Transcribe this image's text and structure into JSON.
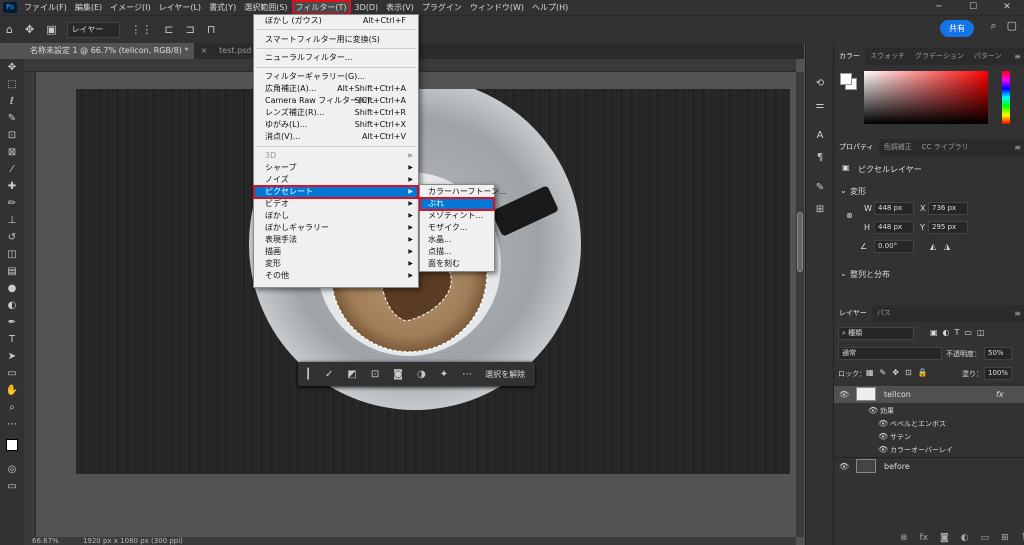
{
  "menubar": {
    "items": [
      "ファイル(F)",
      "編集(E)",
      "イメージ(I)",
      "レイヤー(L)",
      "書式(Y)",
      "選択範囲(S)",
      "フィルター(T)",
      "3D(D)",
      "表示(V)",
      "プラグイン",
      "ウィンドウ(W)",
      "ヘルプ(H)"
    ],
    "active_index": 6
  },
  "options_bar": {
    "layer_select": "レイヤー",
    "share_label": "共有"
  },
  "tabs": [
    {
      "label": "名称未設定 1 @ 66.7% (tellcon, RGB/8) *"
    },
    {
      "label": "test.psd @ 66."
    }
  ],
  "filter_menu": {
    "items": [
      {
        "label": "ぼかし (ガウス)",
        "shortcut": "Alt+Ctrl+F"
      },
      {
        "label": "スマートフィルター用に変換(S)",
        "shortcut": ""
      },
      {
        "label": "ニューラルフィルター...",
        "shortcut": ""
      },
      {
        "label": "フィルターギャラリー(G)...",
        "shortcut": ""
      },
      {
        "label": "広角補正(A)...",
        "shortcut": "Alt+Shift+Ctrl+A"
      },
      {
        "label": "Camera Raw フィルター(C)...",
        "shortcut": "Shift+Ctrl+A"
      },
      {
        "label": "レンズ補正(R)...",
        "shortcut": "Shift+Ctrl+R"
      },
      {
        "label": "ゆがみ(L)...",
        "shortcut": "Shift+Ctrl+X"
      },
      {
        "label": "消点(V)...",
        "shortcut": "Alt+Ctrl+V"
      },
      {
        "label": "3D",
        "shortcut": ""
      },
      {
        "label": "シャープ",
        "shortcut": ""
      },
      {
        "label": "ノイズ",
        "shortcut": ""
      },
      {
        "label": "ピクセレート",
        "shortcut": ""
      },
      {
        "label": "ビデオ",
        "shortcut": ""
      },
      {
        "label": "ぼかし",
        "shortcut": ""
      },
      {
        "label": "ぼかしギャラリー",
        "shortcut": ""
      },
      {
        "label": "表現手法",
        "shortcut": ""
      },
      {
        "label": "描画",
        "shortcut": ""
      },
      {
        "label": "変形",
        "shortcut": ""
      },
      {
        "label": "その他",
        "shortcut": ""
      }
    ]
  },
  "pixelate_submenu": {
    "items": [
      "カラーハーフトーン...",
      "ぶれ",
      "メゾティント...",
      "モザイク...",
      "水晶...",
      "点描...",
      "面を刻む"
    ],
    "highlighted_index": 1
  },
  "context_bar": {
    "deselect_label": "選択を解除"
  },
  "color_panel": {
    "tabs": [
      "カラー",
      "スウォッチ",
      "グラデーション",
      "パターン"
    ]
  },
  "properties_panel": {
    "tabs": [
      "プロパティ",
      "色調補正",
      "CC ライブラリ"
    ],
    "layer_type": "ピクセルレイヤー",
    "transform_label": "変形",
    "w": "448 px",
    "h": "448 px",
    "x": "736 px",
    "y": "295 px",
    "angle": "0.00°",
    "align_label": "整列と分布"
  },
  "layers_panel": {
    "tabs": [
      "レイヤー",
      "パス"
    ],
    "filter_kind": "種類",
    "blend_mode": "通常",
    "opacity_label": "不透明度：",
    "opacity": "50%",
    "lock_label": "ロック：",
    "fill_label": "塗り：",
    "fill": "100%",
    "layers": [
      {
        "name": "tellcon",
        "fx": "fx"
      },
      {
        "name": "効果"
      },
      {
        "name": "ベベルとエンボス"
      },
      {
        "name": "サテン"
      },
      {
        "name": "カラーオーバーレイ"
      },
      {
        "name": "before"
      }
    ]
  },
  "status": {
    "zoom": "66.67%",
    "doc_size": "1920 px x 1080 px (300 ppi)"
  }
}
